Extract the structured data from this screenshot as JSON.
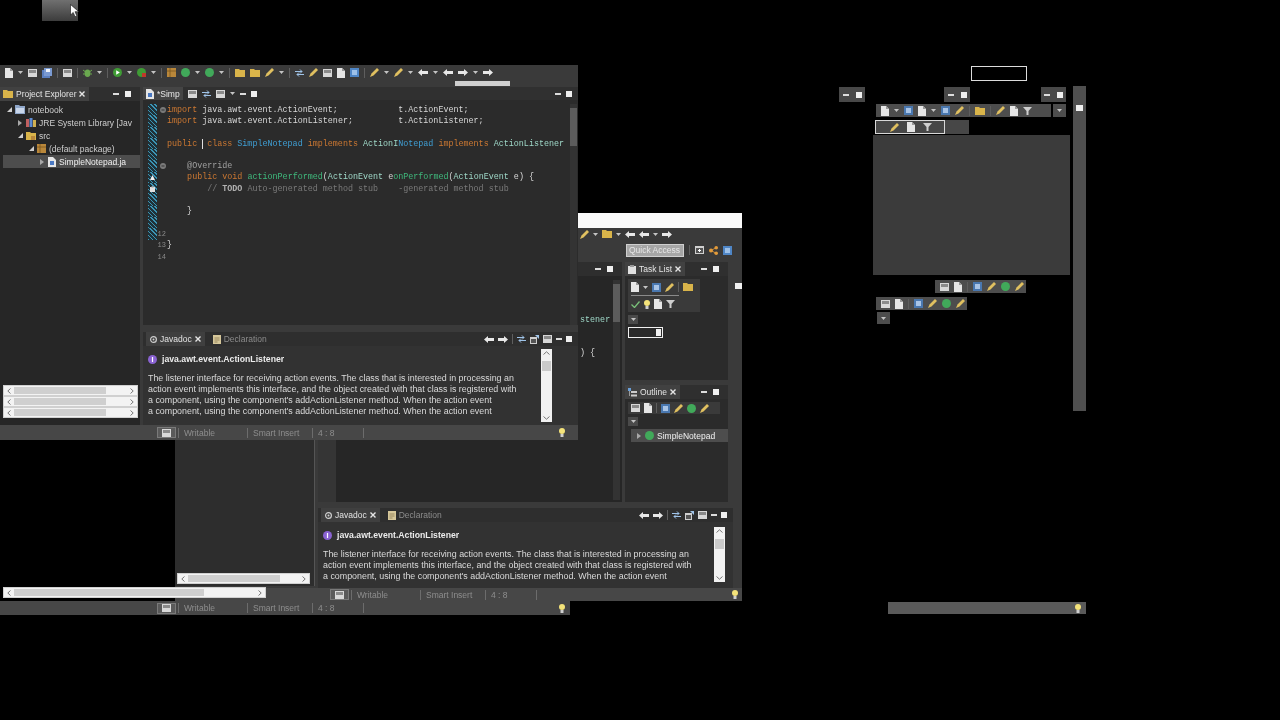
{
  "main_window": {
    "project_explorer": {
      "tab": "Project Explorer",
      "tree": [
        {
          "label": "notebook",
          "kind": "project",
          "expanded": true,
          "selected": false,
          "children": [
            {
              "label": "JRE System Library [Jav",
              "kind": "library",
              "expanded": false,
              "selected": false
            },
            {
              "label": "src",
              "kind": "source_folder",
              "expanded": true,
              "selected": false,
              "children": [
                {
                  "label": "(default package)",
                  "kind": "package",
                  "expanded": true,
                  "selected": false,
                  "children": [
                    {
                      "label": "SimpleNotepad.ja",
                      "kind": "java_file",
                      "expanded": false,
                      "selected": true
                    }
                  ]
                }
              ]
            }
          ]
        }
      ]
    },
    "editor": {
      "tab": "*Simp",
      "lines": [
        {
          "changed": true,
          "marker": {
            "kind": "fold"
          },
          "tokens": [
            {
              "kind": "keyword",
              "text": "import"
            },
            {
              "kind": "plain",
              "text": " java.awt.event.ActionEvent;"
            }
          ],
          "echo": [
            {
              "kind": "plain",
              "text": "t.ActionEvent;"
            }
          ]
        },
        {
          "changed": true,
          "tokens": [
            {
              "kind": "keyword",
              "text": "import"
            },
            {
              "kind": "plain",
              "text": " java.awt.event.ActionListener;"
            }
          ],
          "echo": [
            {
              "kind": "plain",
              "text": "t.ActionListener;"
            }
          ]
        },
        {
          "changed": true
        },
        {
          "changed": true,
          "tokens": [
            {
              "kind": "keyword",
              "text": "public"
            },
            {
              "kind": "caret"
            },
            {
              "kind": "keyword",
              "text": "class"
            },
            {
              "kind": "class",
              "text": " SimpleNotepad"
            },
            {
              "kind": "keyword",
              "text": " implements"
            },
            {
              "kind": "interface",
              "text": " ActionI"
            },
            {
              "kind": "class",
              "text": "Notepad"
            },
            {
              "kind": "keyword",
              "text": " implements"
            },
            {
              "kind": "interface",
              "text": " ActionListener"
            }
          ]
        },
        {
          "changed": true
        },
        {
          "changed": true,
          "marker": {
            "kind": "fold"
          },
          "tokens": [
            {
              "kind": "annotation",
              "text": "    @Override"
            }
          ]
        },
        {
          "changed": true,
          "marker": {
            "kind": "override"
          },
          "tokens": [
            {
              "kind": "keyword",
              "text": "    public"
            },
            {
              "kind": "keyword",
              "text": " void"
            },
            {
              "kind": "method",
              "text": " actionPerformed"
            },
            {
              "kind": "plain",
              "text": "("
            },
            {
              "kind": "interface",
              "text": "ActionEvent"
            },
            {
              "kind": "plain",
              "text": " e"
            },
            {
              "kind": "method",
              "text": "onPerformed"
            },
            {
              "kind": "plain",
              "text": "("
            },
            {
              "kind": "interface",
              "text": "ActionEvent"
            },
            {
              "kind": "plain",
              "text": " e) {"
            }
          ]
        },
        {
          "changed": true,
          "marker": {
            "kind": "task"
          },
          "tokens": [
            {
              "kind": "comment",
              "text": "        // "
            },
            {
              "kind": "task_tag",
              "text": "TODO"
            },
            {
              "kind": "comment",
              "text": " Auto-generated method stub"
            }
          ],
          "echo": [
            {
              "kind": "comment",
              "text": "-generated method stub"
            }
          ]
        },
        {
          "changed": true
        },
        {
          "changed": true,
          "tokens": [
            {
              "kind": "plain",
              "text": "    }"
            }
          ]
        },
        {
          "changed": true
        },
        {
          "changed": true,
          "number": "12"
        },
        {
          "changed": false,
          "number": "13",
          "tokens": [
            {
              "kind": "plain",
              "text": "}"
            }
          ]
        },
        {
          "changed": false,
          "number": "14"
        }
      ]
    },
    "javadoc": {
      "tabs": [
        {
          "label": "Javadoc",
          "selected": true
        },
        {
          "label": "Declaration",
          "selected": false
        }
      ],
      "title": "java.awt.event.ActionListener",
      "description": "The listener interface for receiving action events. The class that is interested in processing an action event implements this interface, and the object created with that class is registered with a component, using the component's addActionListener method. When the action event",
      "echo_line": "a component, using the component's addActionListener method. When the action event"
    },
    "status_bar": {
      "fields": [
        "Writable",
        "Smart Insert",
        "4 : 8"
      ]
    }
  },
  "second_window": {
    "quick_access": {
      "placeholder": "Quick Access"
    },
    "editor": {
      "visible_text": [
        {
          "kind": "interface",
          "text": "stener"
        },
        {
          "kind": "plain",
          "text": ") {"
        }
      ]
    },
    "task_list": {
      "tab": "Task List"
    },
    "outline": {
      "tab": "Outline",
      "items": [
        {
          "label": "SimpleNotepad",
          "kind": "class",
          "expanded": false,
          "selected": true
        }
      ]
    },
    "javadoc": {
      "tabs": [
        {
          "label": "Javadoc",
          "selected": true
        },
        {
          "label": "Declaration",
          "selected": false
        }
      ],
      "title": "java.awt.event.ActionListener",
      "description": "The listener interface for receiving action events. The class that is interested in processing an action event implements this interface, and the object created with that class is registered with a component, using the component's addActionListener method. When the action event"
    },
    "status_bar": {
      "fields": [
        "Writable",
        "Smart Insert",
        "4 : 8"
      ]
    }
  },
  "third_window": {
    "status_bar": {
      "fields": [
        "Writable",
        "Smart Insert",
        "4 : 8"
      ]
    }
  }
}
